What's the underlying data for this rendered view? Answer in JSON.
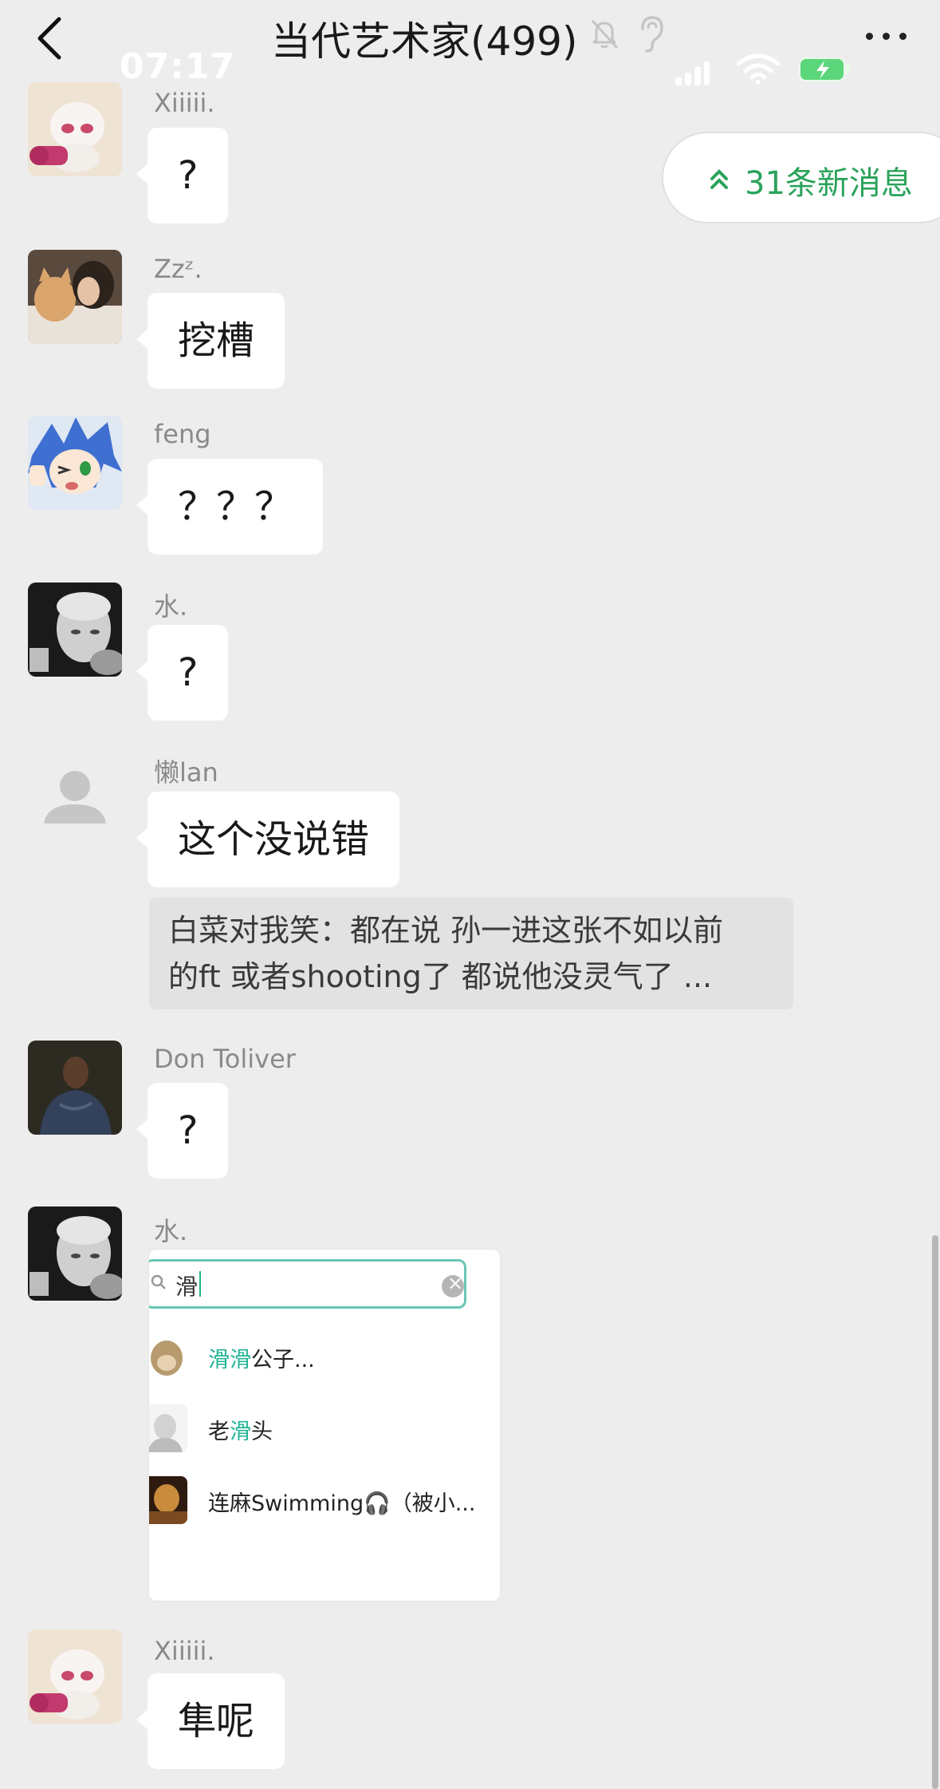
{
  "status_bar": {
    "time": "07:17"
  },
  "header": {
    "title": "当代艺术家(499)"
  },
  "new_messages": {
    "label": "31条新消息"
  },
  "messages": [
    {
      "sender": "Xiiiii.",
      "text": "?"
    },
    {
      "sender": "Zzᶻ.",
      "text": "挖槽"
    },
    {
      "sender": "feng",
      "text": "？？？"
    },
    {
      "sender": "水.",
      "text": "?"
    },
    {
      "sender": "懒lan",
      "text": "这个没说错",
      "quote_line1": "白菜对我笑：都在说 孙一进这张不如以前",
      "quote_line2": "的ft 或者shooting了 都说他没灵气了 ..."
    },
    {
      "sender": "Don Toliver",
      "text": "?"
    },
    {
      "sender": "水.",
      "image": {
        "search_query": "滑",
        "results": [
          {
            "highlight": "滑滑",
            "rest": "公子..."
          },
          {
            "pre": "老",
            "highlight": "滑",
            "rest": "头"
          },
          {
            "name": "连麻Swimming🎧（被小..."
          }
        ]
      }
    },
    {
      "sender": "Xiiiii.",
      "text": "隼呢"
    }
  ],
  "colors": {
    "background": "#ededed",
    "bubble": "#ffffff",
    "accent_green": "#2aa35a"
  }
}
